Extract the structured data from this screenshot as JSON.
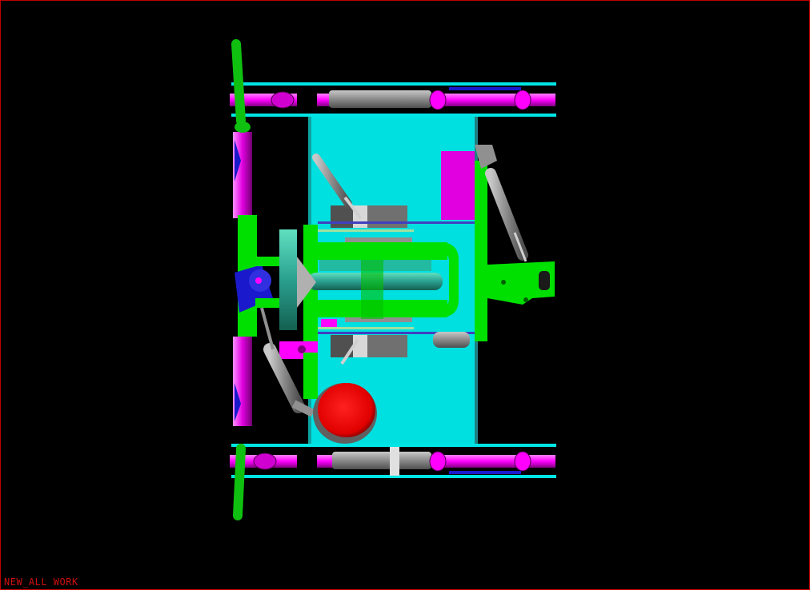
{
  "viewport": {
    "model_name": "NEW_ALL WORK",
    "border_color": "#c00000",
    "label_color": "#d01010",
    "background": "#000000"
  },
  "palette": {
    "frame": "#00ff00",
    "rail": "#00e5e5",
    "plate": "#00e5e5",
    "wheel": "#ff00ff",
    "cylinder": "#909090",
    "bumper": "#ff0000",
    "bracket": "#ff00ff",
    "link": "#1a1acc"
  },
  "components": {
    "steering_arm": "steering-arm",
    "base_plate": "base-plate",
    "top_track": "top-track-assembly",
    "bottom_track": "bottom-track-assembly",
    "gearbox": "center-gearbox",
    "front_cylinder": "front-pneumatic-cylinder",
    "rear_frame": "rear-frame-rail",
    "red_bumper": "red-bumper-disc"
  }
}
